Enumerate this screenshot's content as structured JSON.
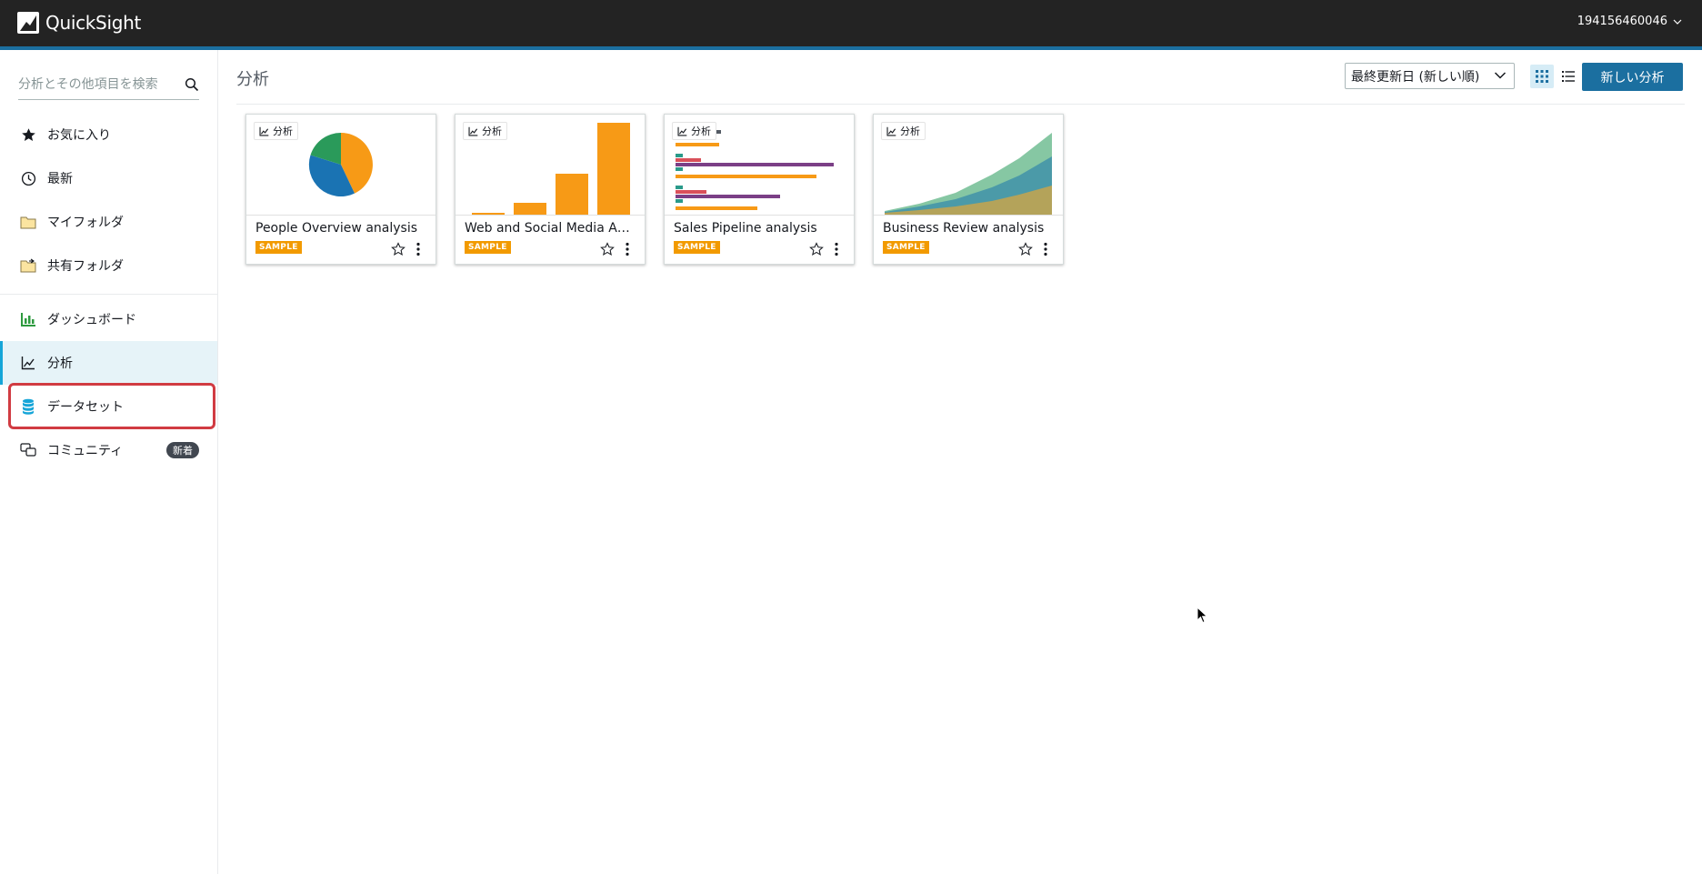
{
  "app": {
    "name": "QuickSight",
    "account": "194156460046"
  },
  "sidebar": {
    "search_placeholder": "分析とその他項目を検索",
    "items": [
      {
        "label": "お気に入り",
        "icon": "star-icon"
      },
      {
        "label": "最新",
        "icon": "clock-icon"
      },
      {
        "label": "マイフォルダ",
        "icon": "folder-icon"
      },
      {
        "label": "共有フォルダ",
        "icon": "shared-folder-icon"
      },
      {
        "label": "ダッシュボード",
        "icon": "dashboard-icon"
      },
      {
        "label": "分析",
        "icon": "analysis-icon",
        "active": true
      },
      {
        "label": "データセット",
        "icon": "dataset-icon",
        "highlighted": true
      },
      {
        "label": "コミュニティ",
        "icon": "community-icon",
        "badge": "新着"
      }
    ]
  },
  "main": {
    "title": "分析",
    "sort": {
      "selected": "最終更新日 (新しい順)"
    },
    "view_modes": [
      "grid",
      "list"
    ],
    "new_button": "新しい分析",
    "cards": [
      {
        "type_label": "分析",
        "title": "People Overview analysis",
        "badge": "SAMPLE",
        "thumbnail": "pie"
      },
      {
        "type_label": "分析",
        "title": "Web and Social Media Anal...",
        "badge": "SAMPLE",
        "thumbnail": "bar"
      },
      {
        "type_label": "分析",
        "title": "Sales Pipeline analysis",
        "badge": "SAMPLE",
        "thumbnail": "horizontal-bar"
      },
      {
        "type_label": "分析",
        "title": "Business Review analysis",
        "badge": "SAMPLE",
        "thumbnail": "area"
      }
    ]
  },
  "colors": {
    "topbar": "#232323",
    "accent": "#1b6fa0",
    "active_bg": "#e6f3f8",
    "highlight_border": "#d13b42",
    "sample_badge": "#f29a00"
  }
}
